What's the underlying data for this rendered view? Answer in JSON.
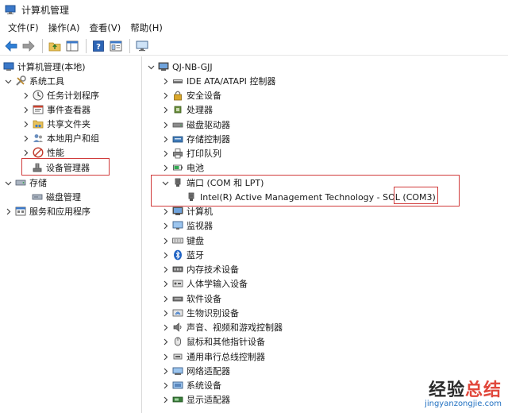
{
  "window": {
    "title": "计算机管理"
  },
  "menu": [
    "文件(F)",
    "操作(A)",
    "查看(V)",
    "帮助(H)"
  ],
  "toolbar": [
    "back-arrow-icon",
    "forward-arrow-icon",
    "up-folder-icon",
    "show-hide-tree-icon",
    "help-icon",
    "properties-icon",
    "monitor-icon"
  ],
  "left_tree": {
    "root": "计算机管理(本地)",
    "system_tools": "系统工具",
    "task_scheduler": "任务计划程序",
    "event_viewer": "事件查看器",
    "shared_folders": "共享文件夹",
    "local_users": "本地用户和组",
    "performance": "性能",
    "device_manager": "设备管理器",
    "storage": "存储",
    "disk_management": "磁盘管理",
    "services_apps": "服务和应用程序"
  },
  "device_tree": {
    "computer_name": "QJ-NB-GJJ",
    "categories": [
      "IDE ATA/ATAPI 控制器",
      "安全设备",
      "处理器",
      "磁盘驱动器",
      "存储控制器",
      "打印队列",
      "电池",
      "端口 (COM 和 LPT)",
      "计算机",
      "监视器",
      "键盘",
      "蓝牙",
      "内存技术设备",
      "人体学输入设备",
      "软件设备",
      "生物识别设备",
      "声音、视频和游戏控制器",
      "鼠标和其他指针设备",
      "通用串行总线控制器",
      "网络适配器",
      "系统设备",
      "显示适配器"
    ],
    "port_child": "Intel(R) Active Management Technology - SOL (COM3)"
  },
  "watermark": {
    "cn_part1": "经验",
    "cn_part2": "总结",
    "en": "jingyanzongjie.com"
  },
  "colors": {
    "highlight": "#d03a3a",
    "selection_border": "#d03a3a"
  }
}
